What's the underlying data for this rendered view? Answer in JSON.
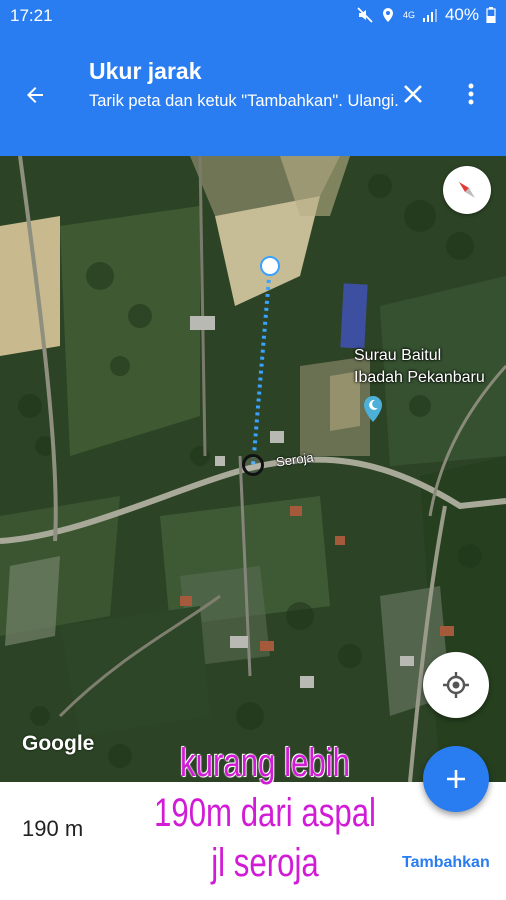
{
  "status_bar": {
    "time": "17:21",
    "network": "4G",
    "battery": "40%",
    "icons": [
      "mute-icon",
      "location-icon",
      "signal-icon",
      "battery-icon"
    ]
  },
  "app_bar": {
    "title": "Ukur jarak",
    "subtitle": "Tarik peta dan ketuk \"Tambahkan\". Ulangi.",
    "back_icon": "arrow-back-icon",
    "close_icon": "close-icon",
    "menu_icon": "more-vert-icon",
    "background": "#2a7df0"
  },
  "map": {
    "type": "satellite",
    "poi": {
      "name_line1": "Surau Baitul",
      "name_line2": "Ibadah Pekanbaru",
      "icon": "mosque-icon"
    },
    "road_label": "Jl. Seroja",
    "road_label_visible": "Seroja",
    "attribution": "Google",
    "compass_icon": "compass-icon",
    "locate_icon": "my-location-icon"
  },
  "measure": {
    "distance": "190 m",
    "add_label": "Tambahkan",
    "fab_icon": "plus-icon",
    "accent": "#2a7df0"
  },
  "annotation": {
    "line1": "kurang lebih",
    "line2": "190m dari aspal",
    "line3": "jl seroja",
    "color": "#d21bd6"
  }
}
